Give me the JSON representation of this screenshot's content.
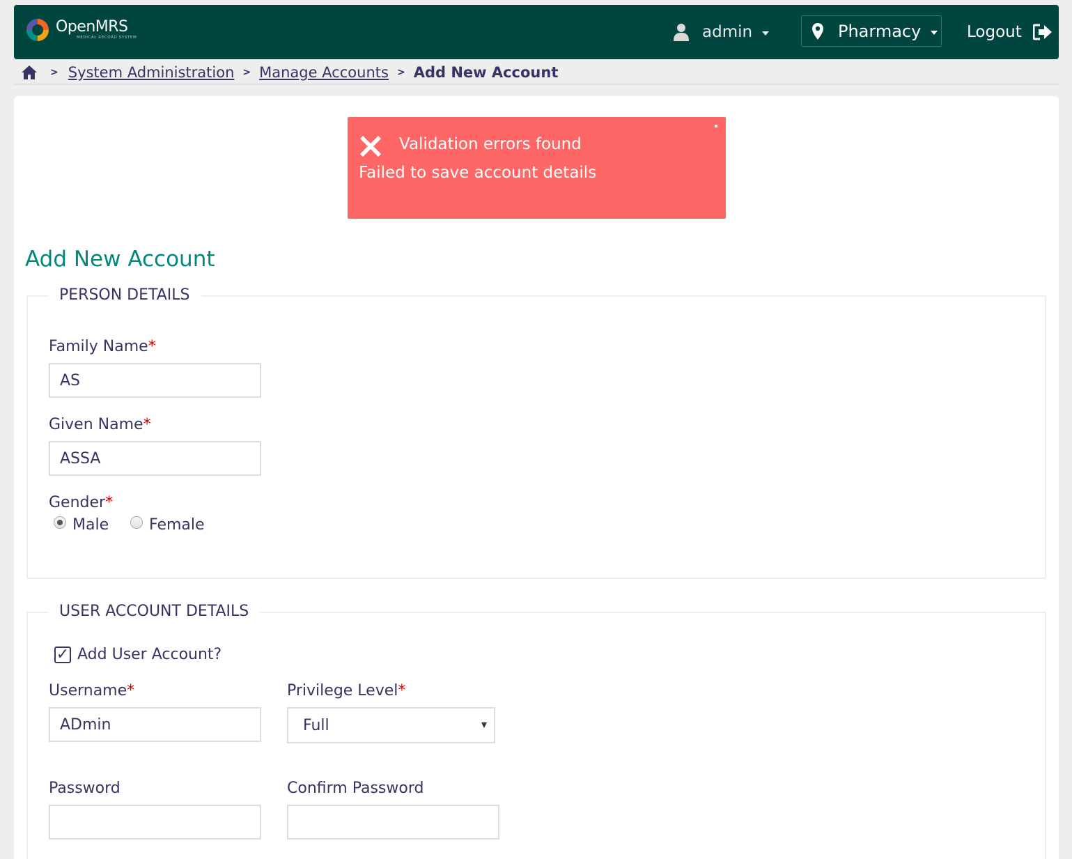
{
  "header": {
    "logo_title": "OpenMRS",
    "logo_subtitle": "MEDICAL RECORD SYSTEM",
    "user": "admin",
    "location": "Pharmacy",
    "logout": "Logout",
    "colors": {
      "background": "#00463f",
      "text": "#ffffff"
    }
  },
  "breadcrumb": {
    "items": [
      "System Administration",
      "Manage Accounts"
    ],
    "current": "Add New Account"
  },
  "alert": {
    "title": "Validation errors found",
    "message": "Failed to save account details",
    "color": "#ff6666"
  },
  "page": {
    "title": "Add New Account",
    "title_color": "#00897b"
  },
  "person_details": {
    "legend": "PERSON DETAILS",
    "family_name_label": "Family Name",
    "family_name_value": "AS",
    "given_name_label": "Given Name",
    "given_name_value": "ASSA",
    "gender_label": "Gender",
    "gender_options": [
      "Male",
      "Female"
    ],
    "gender_selected": "Male",
    "required_marker": "*"
  },
  "user_account": {
    "legend": "USER ACCOUNT DETAILS",
    "add_user_label": "Add User Account?",
    "add_user_checked": true,
    "checkmark": "✓",
    "username_label": "Username",
    "username_value": "ADmin",
    "privilege_label": "Privilege Level",
    "privilege_value": "Full",
    "password_label": "Password",
    "password_value": "",
    "confirm_password_label": "Confirm Password",
    "confirm_password_value": ""
  },
  "icons": [
    "logo-icon",
    "user-icon",
    "chevron-down-icon",
    "map-pin-icon",
    "logout-icon",
    "home-icon",
    "close-icon",
    "error-x-icon",
    "chevron-right-icon"
  ]
}
